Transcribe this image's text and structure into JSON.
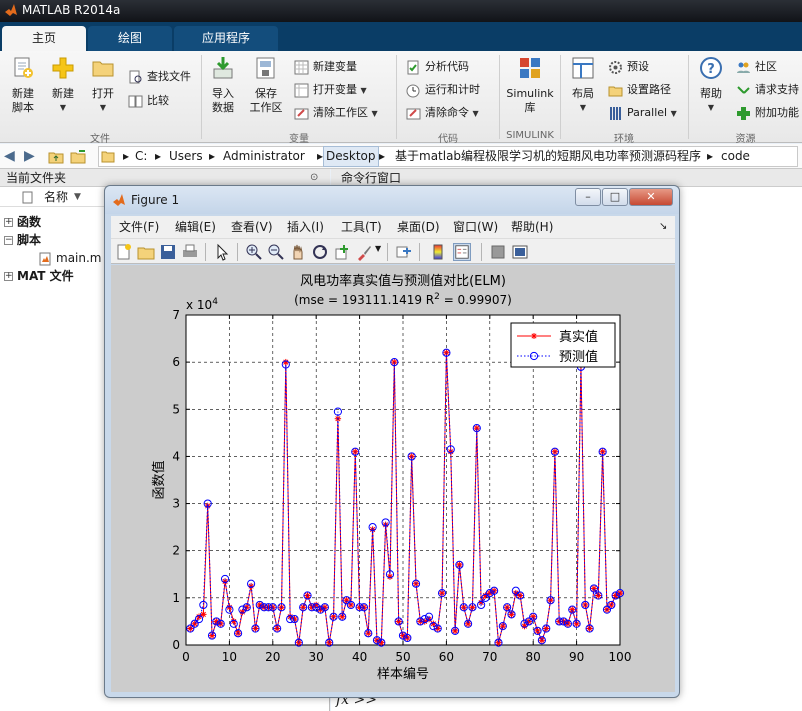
{
  "app": {
    "title": "MATLAB R2014a"
  },
  "ribbon": {
    "tabs": [
      {
        "label": "主页",
        "active": true
      },
      {
        "label": "绘图",
        "active": false
      },
      {
        "label": "应用程序",
        "active": false
      }
    ],
    "file_group": {
      "label": "文件",
      "new_script": [
        "新建",
        "脚本"
      ],
      "new": "新建",
      "open": "打开",
      "find_files": "查找文件",
      "compare": "比较"
    },
    "variable_group": {
      "label": "变量",
      "import": [
        "导入",
        "数据"
      ],
      "save_ws": [
        "保存",
        "工作区"
      ],
      "new_var": "新建变量",
      "open_var": "打开变量",
      "clear_ws": "清除工作区"
    },
    "code_group": {
      "label": "代码",
      "analyze": "分析代码",
      "run_time": "运行和计时",
      "clear_cmd": "清除命令"
    },
    "simulink_group": {
      "label": "SIMULINK",
      "library": [
        "Simulink",
        "库"
      ]
    },
    "env_group": {
      "label": "环境",
      "layout": "布局",
      "prefs": "预设",
      "set_path": "设置路径",
      "parallel": "Parallel"
    },
    "resources_group": {
      "label": "资源",
      "help": "帮助",
      "community": "社区",
      "support": "请求支持",
      "addons": "附加功能"
    }
  },
  "address_bar": {
    "path": [
      "C:",
      "Users",
      "Administrator",
      "Desktop",
      "基于matlab编程极限学习机的短期风电功率预测源码程序",
      "code"
    ]
  },
  "current_folder": {
    "title": "当前文件夹",
    "column_name": "名称",
    "sort_indicator": "▼",
    "tree": [
      {
        "label": "函数",
        "toggle": "+"
      },
      {
        "label": "脚本",
        "toggle": "−"
      },
      {
        "label": "main.m",
        "toggle": ""
      },
      {
        "label": "MAT 文件",
        "toggle": "+"
      }
    ]
  },
  "command_window": {
    "title": "命令行窗口",
    "prompt": "fx >>"
  },
  "figure": {
    "title": "Figure 1",
    "win_buttons": [
      "–",
      "□",
      "✕"
    ],
    "menu": [
      "文件(F)",
      "编辑(E)",
      "查看(V)",
      "插入(I)",
      "工具(T)",
      "桌面(D)",
      "窗口(W)",
      "帮助(H)"
    ],
    "menu_overflow": "↘"
  },
  "colors": {
    "ribbon_tab_bar": "#0a3d66",
    "actual_series": "#ff0000",
    "predicted_series": "#0000ff"
  },
  "chart_data": {
    "type": "line",
    "title": "风电功率真实值与预测值对比(ELM)",
    "subtitle": "(mse = 193111.1419 R",
    "subtitle_sup": "2",
    "subtitle_tail": " = 0.99907)",
    "xlabel": "样本编号",
    "ylabel": "函数值",
    "y_exponent_base": "x 10",
    "y_exponent": "4",
    "xlim": [
      0,
      100
    ],
    "ylim": [
      0,
      7
    ],
    "xticks": [
      0,
      10,
      20,
      30,
      40,
      50,
      60,
      70,
      80,
      90,
      100
    ],
    "yticks": [
      0,
      1,
      2,
      3,
      4,
      5,
      6,
      7
    ],
    "grid": true,
    "legend_position": "top-right",
    "series": [
      {
        "name": "真实值",
        "color": "#ff0000",
        "marker": "asterisk",
        "line": "solid",
        "values": [
          0.35,
          0.45,
          0.6,
          0.65,
          2.95,
          0.2,
          0.5,
          0.45,
          1.35,
          0.8,
          0.5,
          0.25,
          0.7,
          0.8,
          1.25,
          0.35,
          0.85,
          0.8,
          0.8,
          0.8,
          0.35,
          0.8,
          6.0,
          0.6,
          0.55,
          0.05,
          0.8,
          1.05,
          0.8,
          0.85,
          0.75,
          0.8,
          0.05,
          0.6,
          4.8,
          0.6,
          0.95,
          0.85,
          4.1,
          0.8,
          0.8,
          0.25,
          2.45,
          0.1,
          0.05,
          2.55,
          1.45,
          6.0,
          0.5,
          0.2,
          0.15,
          4.0,
          1.3,
          0.5,
          0.5,
          0.55,
          0.45,
          0.35,
          1.1,
          6.2,
          4.1,
          0.3,
          1.7,
          0.8,
          0.45,
          0.8,
          4.6,
          0.9,
          1.05,
          1.1,
          1.15,
          0.05,
          0.4,
          0.8,
          0.65,
          1.1,
          1.05,
          0.4,
          0.5,
          0.6,
          0.3,
          0.1,
          0.35,
          0.95,
          4.1,
          0.5,
          0.5,
          0.45,
          0.75,
          0.45,
          5.95,
          0.85,
          0.35,
          1.2,
          1.05,
          4.1,
          0.75,
          0.85,
          1.05,
          1.1
        ]
      },
      {
        "name": "预测值",
        "color": "#0000ff",
        "marker": "circle",
        "line": "dotted",
        "values": [
          0.35,
          0.45,
          0.55,
          0.85,
          3.0,
          0.2,
          0.5,
          0.45,
          1.4,
          0.75,
          0.45,
          0.25,
          0.75,
          0.8,
          1.3,
          0.35,
          0.85,
          0.8,
          0.8,
          0.8,
          0.35,
          0.8,
          5.95,
          0.55,
          0.55,
          0.05,
          0.8,
          1.05,
          0.8,
          0.8,
          0.75,
          0.8,
          0.05,
          0.6,
          4.95,
          0.6,
          0.95,
          0.85,
          4.1,
          0.8,
          0.8,
          0.25,
          2.5,
          0.1,
          0.05,
          2.6,
          1.5,
          6.0,
          0.5,
          0.2,
          0.15,
          4.0,
          1.3,
          0.5,
          0.55,
          0.6,
          0.4,
          0.35,
          1.1,
          6.2,
          4.15,
          0.3,
          1.7,
          0.8,
          0.45,
          0.8,
          4.6,
          0.85,
          1.0,
          1.1,
          1.15,
          0.05,
          0.4,
          0.8,
          0.65,
          1.15,
          1.05,
          0.45,
          0.5,
          0.6,
          0.3,
          0.1,
          0.35,
          0.95,
          4.1,
          0.5,
          0.5,
          0.45,
          0.75,
          0.45,
          5.9,
          0.85,
          0.35,
          1.2,
          1.05,
          4.1,
          0.75,
          0.85,
          1.05,
          1.1
        ]
      }
    ]
  }
}
